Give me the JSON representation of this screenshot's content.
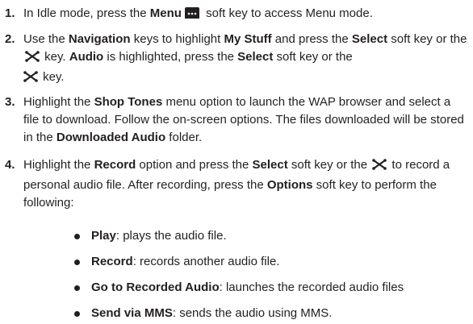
{
  "steps": [
    {
      "number": "1.",
      "t1": "In Idle mode, press the ",
      "b1": "Menu",
      "t2": " soft key to access Menu mode."
    },
    {
      "number": "2.",
      "t1": "Use the ",
      "b1": "Navigation",
      "t2": " keys to highlight ",
      "b2": "My Stuff",
      "t3": " and press the ",
      "b3": "Select",
      "t4": " soft key or the ",
      "t5": " key. ",
      "b4": "Audio",
      "t6": " is highlighted, press the ",
      "b5": "Select",
      "t7": " soft key or the ",
      "t8": " key."
    },
    {
      "number": "3.",
      "t1": "Highlight the ",
      "b1": "Shop Tones",
      "t2": " menu option to launch the WAP browser and select a file to download. Follow the on-screen options. The files downloaded will be stored in the ",
      "b2": "Downloaded Audio",
      "t3": " folder."
    },
    {
      "number": "4.",
      "t1": "Highlight the ",
      "b1": "Record",
      "t2": " option and press the ",
      "b2": "Select",
      "t3": " soft key or the ",
      "t4": " to record a personal audio file.  After recording, press the ",
      "b3": "Options",
      "t5": " soft key to perform the following:"
    }
  ],
  "options": [
    {
      "label": "Play",
      "desc": ": plays the audio file."
    },
    {
      "label": "Record",
      "desc": ": records another audio file."
    },
    {
      "label": "Go to Recorded Audio",
      "desc": ": launches the recorded audio files"
    },
    {
      "label": "Send via MMS",
      "desc": ": sends the audio using MMS."
    }
  ],
  "icons": {
    "menu_key": "menu-soft-key-icon",
    "select_key": "select-key-icon"
  },
  "colors": {
    "text": "#231f20"
  }
}
